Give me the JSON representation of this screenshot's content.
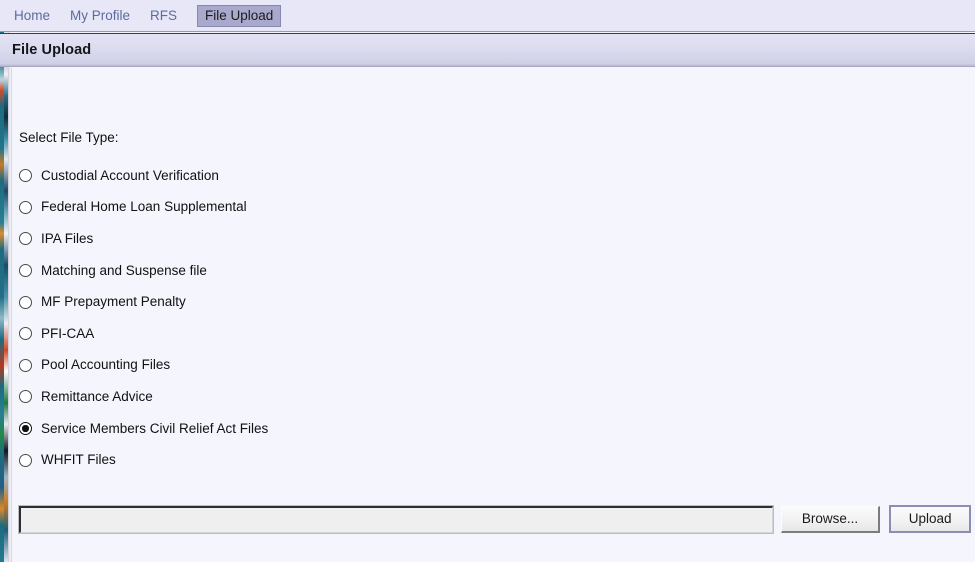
{
  "nav": {
    "items": [
      {
        "label": "Home",
        "active": false
      },
      {
        "label": "My Profile",
        "active": false
      },
      {
        "label": "RFS",
        "active": false
      },
      {
        "label": "File Upload",
        "active": true
      }
    ]
  },
  "header": {
    "title": "File Upload"
  },
  "form": {
    "section_label": "Select File Type:",
    "file_types": [
      {
        "label": "Custodial Account Verification",
        "selected": false
      },
      {
        "label": "Federal Home Loan Supplemental",
        "selected": false
      },
      {
        "label": "IPA Files",
        "selected": false
      },
      {
        "label": "Matching and Suspense file",
        "selected": false
      },
      {
        "label": "MF Prepayment Penalty",
        "selected": false
      },
      {
        "label": "PFI-CAA",
        "selected": false
      },
      {
        "label": "Pool Accounting Files",
        "selected": false
      },
      {
        "label": "Remittance Advice",
        "selected": false
      },
      {
        "label": "Service Members Civil Relief Act Files",
        "selected": true
      },
      {
        "label": "WHFIT Files",
        "selected": false
      }
    ],
    "file_path_value": "",
    "file_path_placeholder": "",
    "browse_label": "Browse...",
    "upload_label": "Upload"
  },
  "colors": {
    "nav_background": "#e7e7f8",
    "nav_link": "#5b6c9b",
    "active_tab_background": "#a9a9cd",
    "header_band": "#dcdcf0",
    "content_background": "#f5f5fd",
    "upload_button_border": "#8c8cb4"
  }
}
